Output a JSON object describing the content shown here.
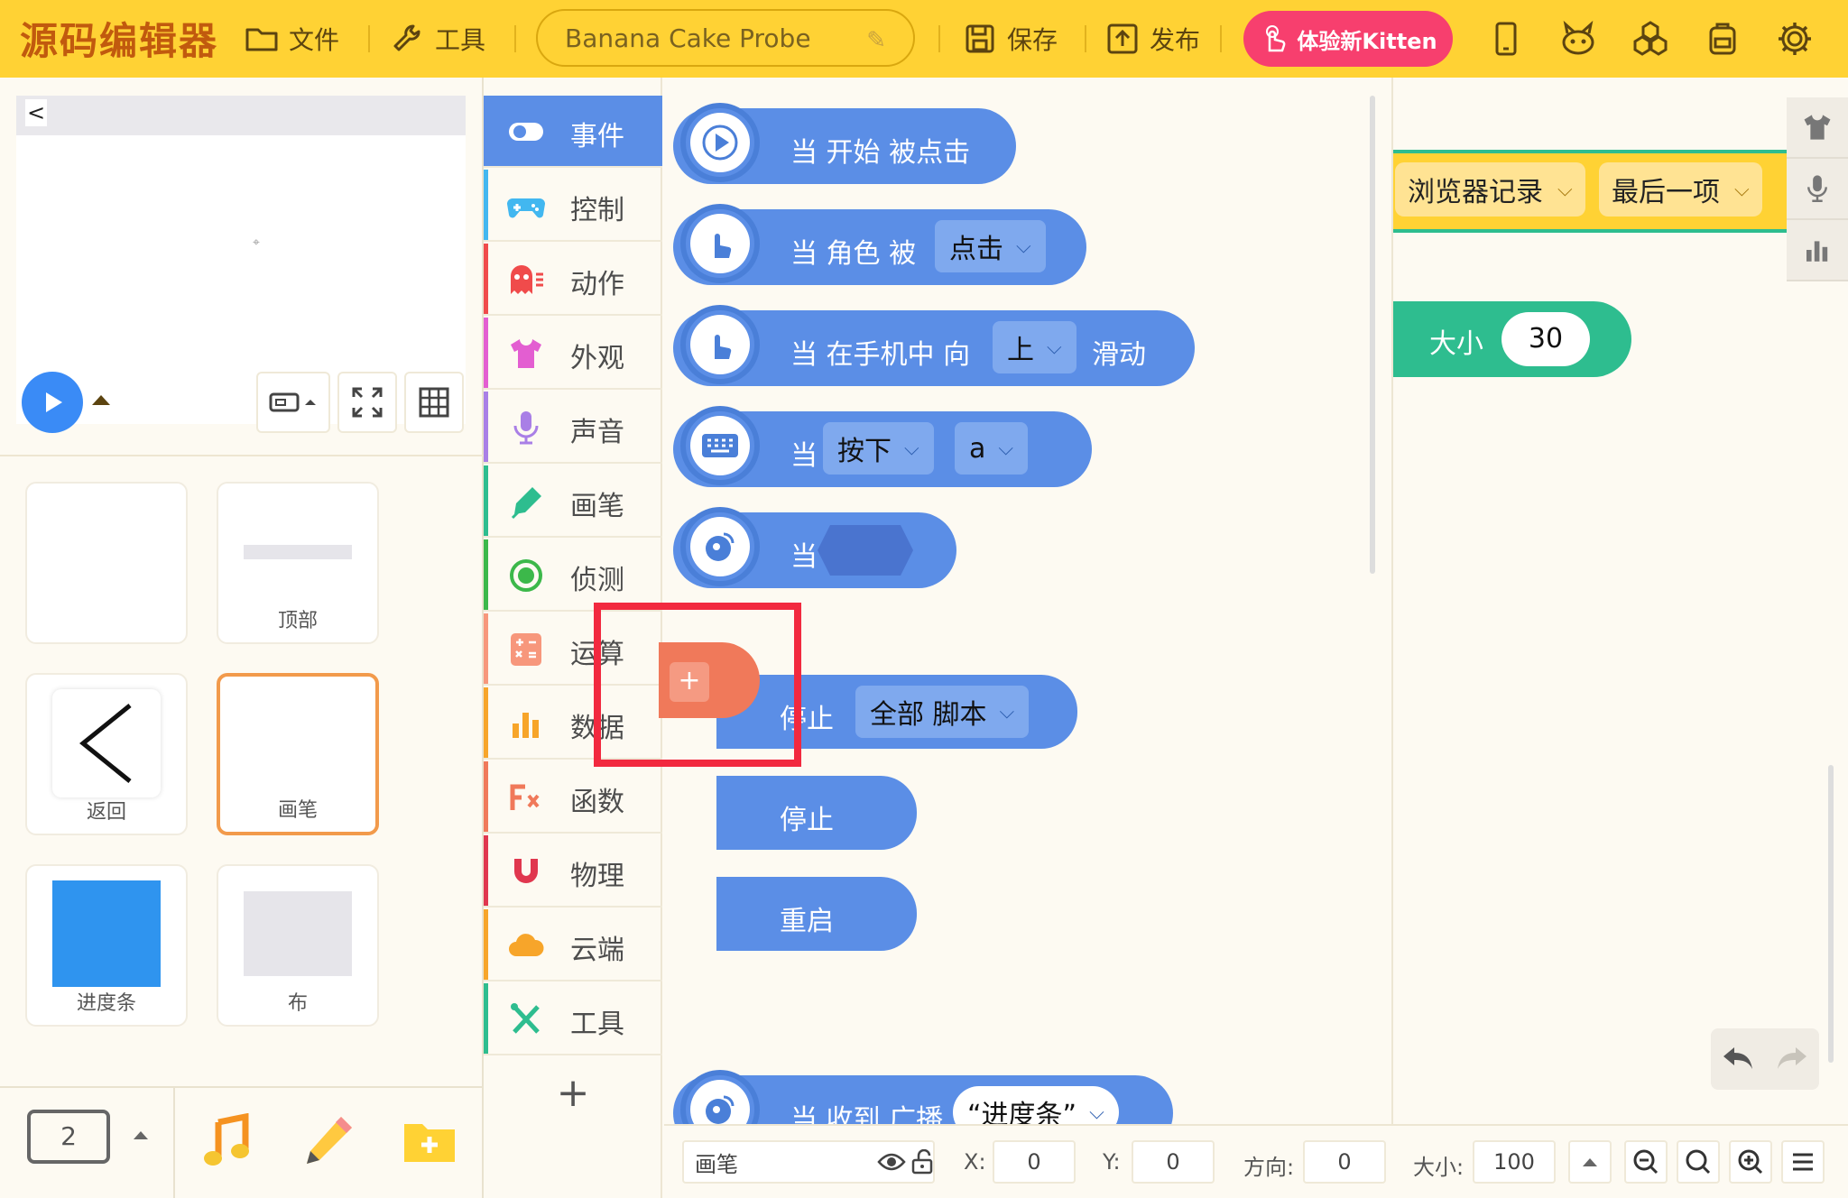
{
  "app": {
    "title": "源码编辑器"
  },
  "toolbar": {
    "file": "文件",
    "tools": "工具",
    "project_title": "Banana Cake Probe",
    "save": "保存",
    "publish": "发布",
    "try_kitten": "体验新Kitten"
  },
  "stage": {
    "back_glyph": "<",
    "center_glyph": "⌖"
  },
  "sprites": [
    {
      "name": ""
    },
    {
      "name": "顶部"
    },
    {
      "name": "返回"
    },
    {
      "name": "画笔"
    },
    {
      "name": "进度条"
    },
    {
      "name": "布"
    }
  ],
  "bottom_tools": {
    "screen_count": "2"
  },
  "categories": [
    {
      "label": "事件",
      "color": "#5b8ee6",
      "icon": "toggle-icon"
    },
    {
      "label": "控制",
      "color": "#42b7f0",
      "icon": "gamepad-icon"
    },
    {
      "label": "动作",
      "color": "#f04b4b",
      "icon": "ghost-icon"
    },
    {
      "label": "外观",
      "color": "#e35ed1",
      "icon": "shirt-icon"
    },
    {
      "label": "声音",
      "color": "#a97fe6",
      "icon": "microphone-icon"
    },
    {
      "label": "画笔",
      "color": "#2ebd8f",
      "icon": "pen-icon"
    },
    {
      "label": "侦测",
      "color": "#3cb84a",
      "icon": "target-icon"
    },
    {
      "label": "运算",
      "color": "#f7977c",
      "icon": "calculator-icon"
    },
    {
      "label": "数据",
      "color": "#f7a52a",
      "icon": "bar-chart-icon"
    },
    {
      "label": "函数",
      "color": "#f0795a",
      "icon": "function-icon"
    },
    {
      "label": "物理",
      "color": "#e0374f",
      "icon": "magnet-icon"
    },
    {
      "label": "云端",
      "color": "#f7a52a",
      "icon": "cloud-icon"
    },
    {
      "label": "工具",
      "color": "#2ebd8f",
      "icon": "wrench-icon"
    }
  ],
  "blocks": {
    "when_start": "当 开始 被点击",
    "when_sprite_prefix": "当 角色 被",
    "when_sprite_option": "点击",
    "when_swipe_prefix": "当 在手机中 向",
    "when_swipe_option": "上",
    "when_swipe_suffix": "滑动",
    "when_key_prefix": "当",
    "when_key_action": "按下",
    "when_key_key": "a",
    "when_condition": "当",
    "stop_prefix": "停止",
    "stop_option": "全部 脚本",
    "stop": "停止",
    "restart": "重启",
    "when_receive_prefix": "当 收到 广播",
    "when_receive_option": "“进度条”"
  },
  "workspace": {
    "list_option": "浏览器记录",
    "item_option": "最后一项",
    "size_label": "大小",
    "size_value": "30"
  },
  "status": {
    "sprite_name": "画笔",
    "x_label": "X:",
    "x_value": "0",
    "y_label": "Y:",
    "y_value": "0",
    "direction_label": "方向:",
    "direction_value": "0",
    "size_label": "大小:",
    "size_value": "100"
  }
}
